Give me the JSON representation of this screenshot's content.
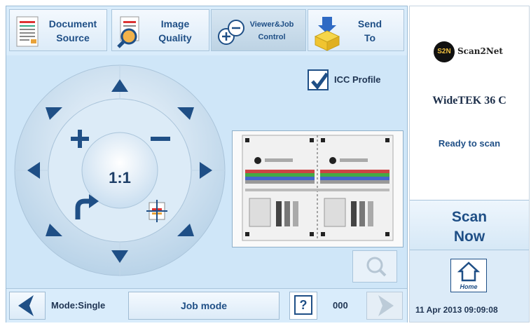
{
  "tabs": [
    {
      "line1": "Document",
      "line2": "Source",
      "icon": "document-icon"
    },
    {
      "line1": "Image",
      "line2": "Quality",
      "icon": "magnifier-icon"
    },
    {
      "line1": "Viewer&Job",
      "line2": "Control",
      "icon": "zoom-in-out-icon"
    },
    {
      "line1": "Send",
      "line2": "To",
      "icon": "send-box-icon"
    }
  ],
  "viewer": {
    "ratio_label": "1:1",
    "icc_label": "ICC Profile",
    "icc_checked": true
  },
  "bottom": {
    "mode_label": "Mode:Single",
    "job_mode_label": "Job mode",
    "help_label": "?",
    "counter": "000"
  },
  "right_panel": {
    "logo_mark": "S2N",
    "logo_text": "Scan2Net",
    "model": "WideTEK 36 C",
    "status": "Ready to scan",
    "scan_line1": "Scan",
    "scan_line2": "Now",
    "home_label": "Home",
    "datetime": "11 Apr 2013 09:09:08"
  },
  "colors": {
    "accent": "#1f4f86",
    "panel_bg": "#cfe6f8"
  }
}
